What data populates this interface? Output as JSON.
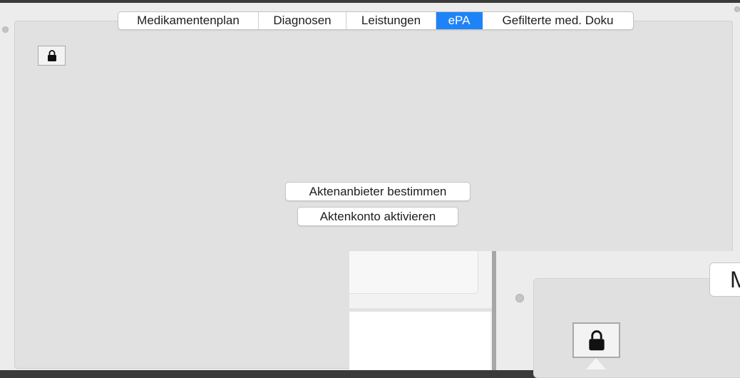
{
  "tabs": [
    {
      "label": "Medikamentenplan",
      "active": false
    },
    {
      "label": "Diagnosen",
      "active": false
    },
    {
      "label": "Leistungen",
      "active": false
    },
    {
      "label": "ePA",
      "active": true
    },
    {
      "label": "Gefilterte med. Doku",
      "active": false
    }
  ],
  "main": {
    "lock_icon": "lock-icon",
    "buttons": {
      "determine_provider": "Aktenanbieter bestimmen",
      "activate_account": "Aktenkonto aktivieren"
    }
  },
  "overlay": {
    "partial_tab_label": "M",
    "lock_icon": "lock-icon"
  },
  "colors": {
    "accent": "#1f83f8",
    "panel": "#e1e1e1",
    "background": "#ececec"
  }
}
